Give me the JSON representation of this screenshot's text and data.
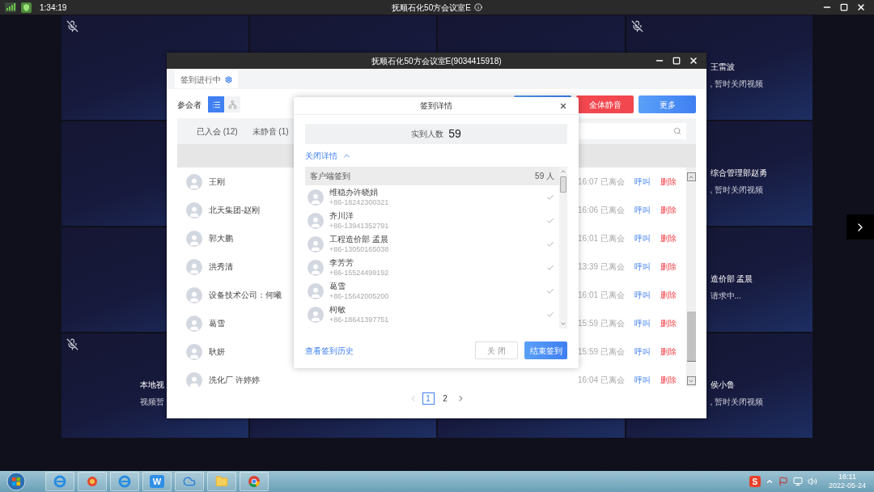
{
  "top_bar": {
    "time": "1:34:19",
    "title": "抚顺石化50方会议室E"
  },
  "video_grid": {
    "left_tiles": [
      {
        "mic_muted": true
      },
      {
        "mic_muted": false
      },
      {
        "mic_muted": false
      },
      {
        "mic_muted": true,
        "name": "本地视",
        "status": "视频暂"
      }
    ],
    "top_tiles": [
      {
        "mic_muted": false
      },
      {
        "mic_muted": false
      }
    ],
    "right_tiles": [
      {
        "mic_muted": true,
        "name": "王雷波",
        "status": ", 暂时关闭视频"
      },
      {
        "name": "综合管理部赵勇",
        "status": ", 暂时关闭视频"
      },
      {
        "name": "造价部 孟晨",
        "status": "请求中..."
      },
      {
        "name": "侯小鲁",
        "status": ", 暂时关闭视频"
      }
    ]
  },
  "meeting_window": {
    "title": "抚顺石化50方会议室E(9034415918)",
    "tab": {
      "label": "签到进行中"
    },
    "section_label": "参会者",
    "view_toggles": [
      {
        "kind": "list",
        "selected": true
      },
      {
        "kind": "tree",
        "selected": false
      }
    ],
    "buttons": [
      {
        "kind": "primary"
      },
      {
        "kind": "danger",
        "label": "全体静音"
      },
      {
        "kind": "primary",
        "label": "更多"
      }
    ],
    "filters": [
      {
        "label": "已入会 (12)",
        "selected": false
      },
      {
        "label": "未静音 (1)",
        "selected": false
      }
    ],
    "participants": [
      {
        "name": "王刚",
        "time": "16:07",
        "status": "已离会",
        "call": "呼叫",
        "remove": "删除"
      },
      {
        "name": "北天集团-赵刚",
        "time": "16:06",
        "status": "已离会",
        "call": "呼叫",
        "remove": "删除"
      },
      {
        "name": "郭大鹏",
        "time": "16:01",
        "status": "已离会",
        "call": "呼叫",
        "remove": "删除"
      },
      {
        "name": "洪秀清",
        "time": "13:39",
        "status": "已离会",
        "call": "呼叫",
        "remove": "删除"
      },
      {
        "name": "设备技术公司：何曦",
        "time": "16:01",
        "status": "已离会",
        "call": "呼叫",
        "remove": "删除"
      },
      {
        "name": "葛雪",
        "time": "15:59",
        "status": "已离会",
        "call": "呼叫",
        "remove": "删除"
      },
      {
        "name": "耿妍",
        "time": "15:59",
        "status": "已离会",
        "call": "呼叫",
        "remove": "删除"
      },
      {
        "name": "洗化厂 许婷婷",
        "time": "16:04",
        "status": "已离会",
        "call": "呼叫",
        "remove": "删除"
      }
    ],
    "pages": [
      {
        "label": "1",
        "selected": true
      },
      {
        "label": "2",
        "selected": false
      }
    ]
  },
  "checkin_dialog": {
    "title": "签到详情",
    "stat_label": "实到人数",
    "stat_value": "59",
    "toggle": "关闭详情",
    "group_label": "客户端签到",
    "group_count": "59 人",
    "entries": [
      {
        "name": "维稳办许晓娟",
        "phone": "+86-18242300321",
        "checked": true
      },
      {
        "name": "齐川洋",
        "phone": "+86-13941352791",
        "checked": true
      },
      {
        "name": "工程造价部 孟晨",
        "phone": "+86-13050165038",
        "checked": true
      },
      {
        "name": "李芳芳",
        "phone": "+86-15524499192",
        "checked": true
      },
      {
        "name": "葛雪",
        "phone": "+86-15642005200",
        "checked": true
      },
      {
        "name": "柯敏",
        "phone": "+86-18641397751",
        "checked": true
      }
    ],
    "history_link": "查看签到历史",
    "close_button": "关 闭",
    "end_button": "结束签到"
  },
  "taskbar": {
    "wps_label": "W",
    "input_label": "S",
    "time": "16:11",
    "date": "2022-05-24"
  }
}
